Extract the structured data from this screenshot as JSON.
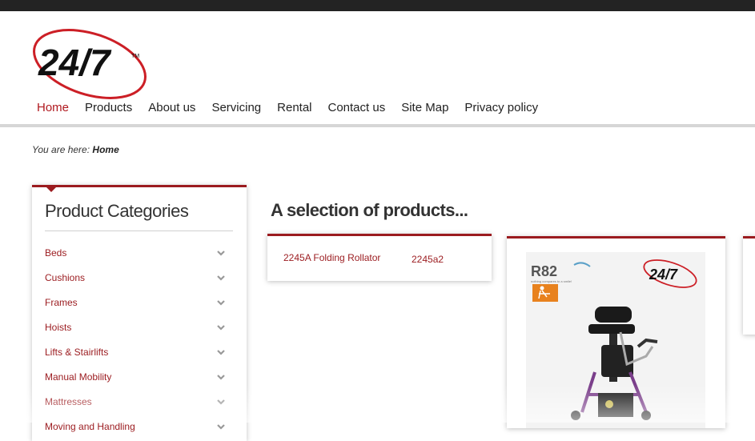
{
  "logo": {
    "text": "24/7",
    "trademark": "TM",
    "accent_color": "#cc1f26"
  },
  "nav": {
    "items": [
      {
        "label": "Home",
        "active": true
      },
      {
        "label": "Products"
      },
      {
        "label": "About us"
      },
      {
        "label": "Servicing"
      },
      {
        "label": "Rental"
      },
      {
        "label": "Contact us"
      },
      {
        "label": "Site Map"
      },
      {
        "label": "Privacy policy"
      }
    ]
  },
  "breadcrumb": {
    "prefix": "You are here:",
    "current": "Home"
  },
  "sidebar": {
    "title": "Product Categories",
    "categories": [
      "Beds",
      "Cushions",
      "Frames",
      "Hoists",
      "Lifts & Stairlifts",
      "Manual Mobility",
      "Mattresses",
      "Moving and Handling"
    ]
  },
  "main": {
    "title": "A selection of products...",
    "product1": {
      "name": "2245A Folding Rollator",
      "code": "2245a2"
    },
    "product2": {
      "brand": "R82",
      "tagline": "nothing compares to a smile!",
      "logo_text": "24/7"
    }
  },
  "colors": {
    "brand_red": "#9b1b1f",
    "nav_active": "#b0191f",
    "topbar": "#232323"
  }
}
